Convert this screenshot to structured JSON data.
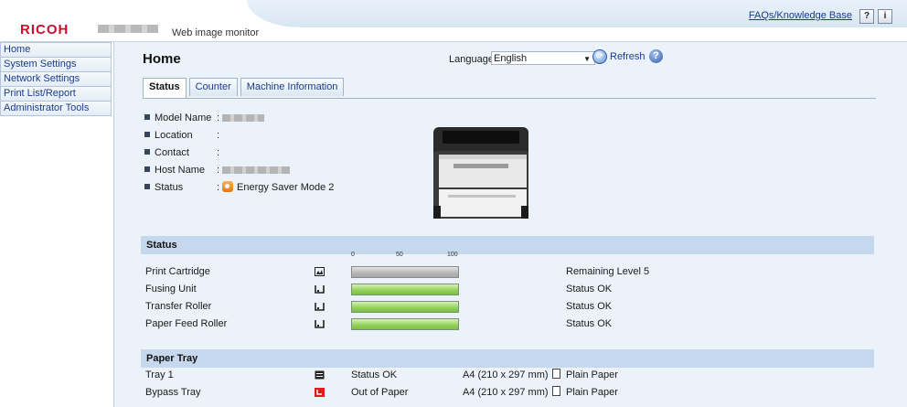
{
  "header": {
    "brand": "RICOH",
    "app_name": "Web image monitor",
    "faq_link": "FAQs/Knowledge Base",
    "help_button": "?",
    "info_button": "i"
  },
  "sidebar": {
    "items": [
      {
        "label": "Home"
      },
      {
        "label": "System Settings"
      },
      {
        "label": "Network Settings"
      },
      {
        "label": "Print List/Report"
      },
      {
        "label": "Administrator Tools"
      }
    ]
  },
  "main": {
    "title": "Home",
    "language_label": "Language",
    "language_value": "English",
    "refresh_label": "Refresh",
    "tabs": [
      {
        "label": "Status"
      },
      {
        "label": "Counter"
      },
      {
        "label": "Machine Information"
      }
    ],
    "info": [
      {
        "label": "Model Name",
        "value": ""
      },
      {
        "label": "Location",
        "value": ""
      },
      {
        "label": "Contact",
        "value": ""
      },
      {
        "label": "Host Name",
        "value": ""
      },
      {
        "label": "Status",
        "value": "Energy Saver Mode 2"
      }
    ]
  },
  "status_section": {
    "title": "Status",
    "scale": [
      "0",
      "50",
      "100"
    ],
    "items": [
      {
        "name": "Print Cartridge",
        "icon": "toner-icon",
        "status": "Remaining Level 5",
        "level_percent": 100,
        "bar_color": "#a8a8a8"
      },
      {
        "name": "Fusing Unit",
        "icon": "unit-icon",
        "status": "Status OK",
        "level_percent": 100,
        "bar_color": "#8fd05a"
      },
      {
        "name": "Transfer Roller",
        "icon": "unit-icon",
        "status": "Status OK",
        "level_percent": 100,
        "bar_color": "#8fd05a"
      },
      {
        "name": "Paper Feed Roller",
        "icon": "unit-icon",
        "status": "Status OK",
        "level_percent": 100,
        "bar_color": "#8fd05a"
      }
    ]
  },
  "paper_section": {
    "title": "Paper Tray",
    "trays": [
      {
        "name": "Tray 1",
        "icon": "tray-ok-icon",
        "status": "Status OK",
        "size": "A4 (210 x 297 mm)",
        "type": "Plain Paper"
      },
      {
        "name": "Bypass Tray",
        "icon": "tray-empty-icon",
        "status": "Out of Paper",
        "size": "A4 (210 x 297 mm)",
        "type": "Plain Paper"
      }
    ]
  },
  "colors": {
    "brand_red": "#c8102e",
    "link_blue": "#1a3c8c",
    "section_header": "#c6d8ed",
    "main_bg": "#ebf2f9",
    "status_orange": "#e8780d",
    "alert_red": "#d81e1e"
  }
}
